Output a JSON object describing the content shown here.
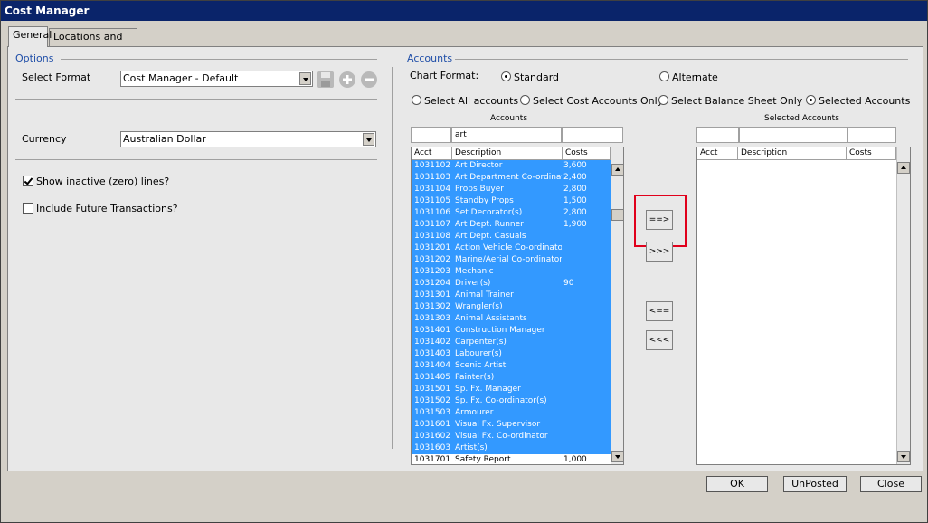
{
  "window": {
    "title": "Cost Manager"
  },
  "tabs": [
    {
      "label": "General"
    },
    {
      "label": "Locations and Sets"
    }
  ],
  "options": {
    "group_title": "Options",
    "select_format_label": "Select Format",
    "select_format_value": "Cost Manager - Default",
    "currency_label": "Currency",
    "currency_value": "Australian Dollar",
    "show_inactive_label": "Show inactive (zero) lines?",
    "show_inactive_checked": true,
    "include_future_label": "Include Future Transactions?",
    "include_future_checked": false
  },
  "accounts": {
    "group_title": "Accounts",
    "chart_format_label": "Chart Format:",
    "chart_format_options": [
      {
        "label": "Standard",
        "selected": true
      },
      {
        "label": "Alternate",
        "selected": false
      }
    ],
    "select_options": [
      {
        "label": "Select All accounts",
        "selected": false
      },
      {
        "label": "Select Cost Accounts Only",
        "selected": false
      },
      {
        "label": "Select Balance Sheet Only",
        "selected": false
      },
      {
        "label": "Selected Accounts",
        "selected": true
      }
    ],
    "list_title": "Accounts",
    "filter_value": "art",
    "columns": [
      "Acct",
      "Description",
      "Costs"
    ],
    "rows": [
      {
        "acct": "1031102",
        "desc": "Art Director",
        "costs": "3,600"
      },
      {
        "acct": "1031103",
        "desc": "Art Department Co-ordinator",
        "costs": "2,400"
      },
      {
        "acct": "1031104",
        "desc": "Props Buyer",
        "costs": "2,800"
      },
      {
        "acct": "1031105",
        "desc": "Standby Props",
        "costs": "1,500"
      },
      {
        "acct": "1031106",
        "desc": "Set Decorator(s)",
        "costs": "2,800"
      },
      {
        "acct": "1031107",
        "desc": "Art Dept. Runner",
        "costs": "1,900"
      },
      {
        "acct": "1031108",
        "desc": "Art Dept. Casuals",
        "costs": ""
      },
      {
        "acct": "1031201",
        "desc": "Action Vehicle Co-ordinator.",
        "costs": ""
      },
      {
        "acct": "1031202",
        "desc": "Marine/Aerial Co-ordinator",
        "costs": ""
      },
      {
        "acct": "1031203",
        "desc": "Mechanic",
        "costs": ""
      },
      {
        "acct": "1031204",
        "desc": "Driver(s)",
        "costs": "90"
      },
      {
        "acct": "1031301",
        "desc": "Animal Trainer",
        "costs": ""
      },
      {
        "acct": "1031302",
        "desc": "Wrangler(s)",
        "costs": ""
      },
      {
        "acct": "1031303",
        "desc": "Animal Assistants",
        "costs": ""
      },
      {
        "acct": "1031401",
        "desc": "Construction Manager",
        "costs": ""
      },
      {
        "acct": "1031402",
        "desc": "Carpenter(s)",
        "costs": ""
      },
      {
        "acct": "1031403",
        "desc": "Labourer(s)",
        "costs": ""
      },
      {
        "acct": "1031404",
        "desc": "Scenic Artist",
        "costs": ""
      },
      {
        "acct": "1031405",
        "desc": "Painter(s)",
        "costs": ""
      },
      {
        "acct": "1031501",
        "desc": "Sp. Fx. Manager",
        "costs": ""
      },
      {
        "acct": "1031502",
        "desc": "Sp. Fx. Co-ordinator(s)",
        "costs": ""
      },
      {
        "acct": "1031503",
        "desc": "Armourer",
        "costs": ""
      },
      {
        "acct": "1031601",
        "desc": "Visual Fx. Supervisor",
        "costs": ""
      },
      {
        "acct": "1031602",
        "desc": "Visual Fx. Co-ordinator",
        "costs": ""
      },
      {
        "acct": "1031603",
        "desc": "Artist(s)",
        "costs": ""
      },
      {
        "acct": "1031701",
        "desc": "Safety Report",
        "costs": "1,000"
      }
    ],
    "selected_title": "Selected Accounts",
    "selected_columns": [
      "Acct",
      "Description",
      "Costs"
    ]
  },
  "move_buttons": {
    "add": "==>",
    "add_all": ">>>",
    "remove": "<==",
    "remove_all": "<<<"
  },
  "footer": {
    "ok": "OK",
    "unposted": "UnPosted",
    "close": "Close"
  },
  "colors": {
    "selection": "#3399ff",
    "title_bar": "#0a246a",
    "highlight": "#e0001b",
    "group_title": "#1f4ea8"
  }
}
